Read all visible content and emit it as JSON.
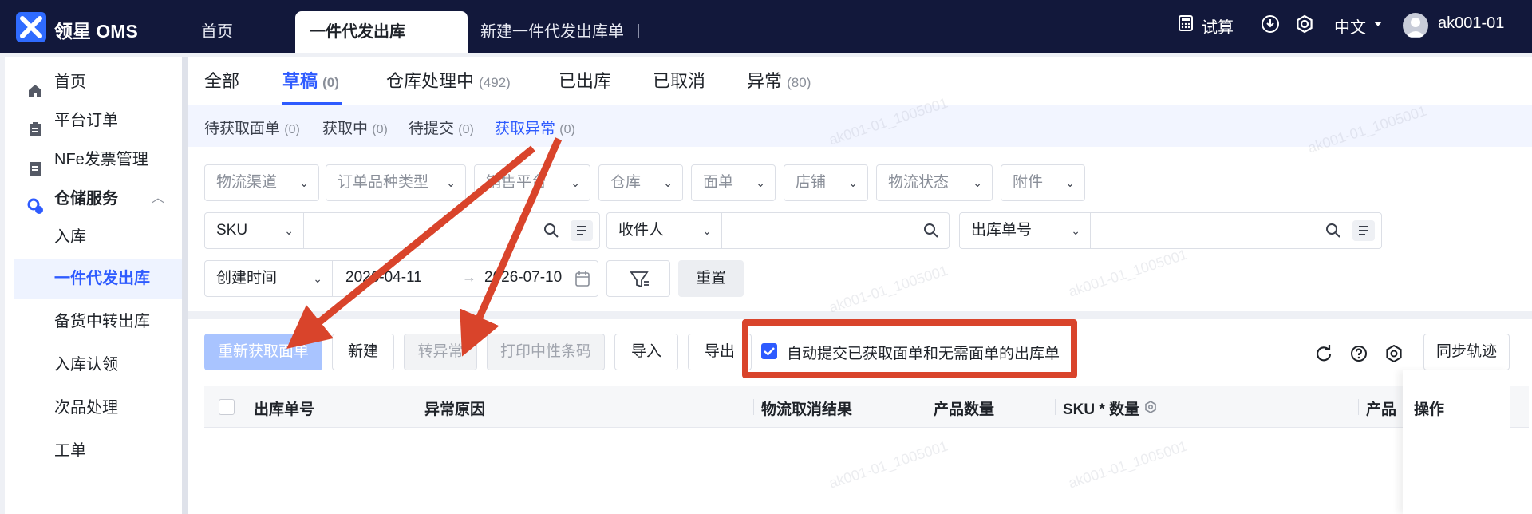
{
  "app": {
    "brand": "领星 OMS",
    "colors": {
      "topbar": "#12183b",
      "accent": "#2e5bff",
      "annotation": "#d9442b"
    }
  },
  "topnav": {
    "tabs": [
      {
        "label": "首页"
      },
      {
        "label": "一件代发出库"
      },
      {
        "label": "新建一件代发出库单"
      }
    ],
    "trial_calc": "试算",
    "language": "中文",
    "user": "ak001-01",
    "icons": [
      "calculator-icon",
      "download-icon",
      "settings-icon",
      "user-avatar"
    ]
  },
  "sidebar": {
    "items": [
      {
        "label": "首页",
        "icon": "home-icon"
      },
      {
        "label": "平台订单",
        "icon": "clipboard-icon"
      },
      {
        "label": "NFe发票管理",
        "icon": "invoice-icon"
      },
      {
        "label": "仓储服务",
        "icon": "warehouse-icon"
      },
      {
        "label": "入库"
      },
      {
        "label": "一件代发出库"
      },
      {
        "label": "备货中转出库"
      },
      {
        "label": "入库认领"
      },
      {
        "label": "次品处理"
      },
      {
        "label": "工单"
      }
    ]
  },
  "status_tabs": [
    {
      "label": "全部",
      "count": ""
    },
    {
      "label": "草稿",
      "count": "(0)"
    },
    {
      "label": "仓库处理中",
      "count": "(492)"
    },
    {
      "label": "已出库",
      "count": ""
    },
    {
      "label": "已取消",
      "count": ""
    },
    {
      "label": "异常",
      "count": "(80)"
    }
  ],
  "sub_tabs": [
    {
      "label": "待获取面单",
      "count": "(0)"
    },
    {
      "label": "获取中",
      "count": "(0)"
    },
    {
      "label": "待提交",
      "count": "(0)"
    },
    {
      "label": "获取异常",
      "count": "(0)"
    }
  ],
  "filters": {
    "selects": [
      "物流渠道",
      "订单品种类型",
      "销售平台",
      "仓库",
      "面单",
      "店铺",
      "物流状态",
      "附件"
    ],
    "search1": {
      "field": "SKU",
      "value": ""
    },
    "search2": {
      "field": "收件人",
      "value": ""
    },
    "search3": {
      "field": "出库单号",
      "value": ""
    },
    "date": {
      "field": "创建时间",
      "start": "2026-04-11",
      "end": "2026-07-10"
    },
    "reset": "重置"
  },
  "actions": {
    "refetch": "重新获取面单",
    "new": "新建",
    "to_exception": "转异常",
    "print_barcode": "打印中性条码",
    "import": "导入",
    "export": "导出",
    "auto_submit_label": "自动提交已获取面单和无需面单的出库单",
    "auto_submit_checked": true,
    "sync": "同步轨迹"
  },
  "table": {
    "columns": [
      "出库单号",
      "异常原因",
      "物流取消结果",
      "产品数量",
      "SKU * 数量",
      "产品",
      "操作"
    ]
  },
  "watermark": "ak001-01_1005001"
}
